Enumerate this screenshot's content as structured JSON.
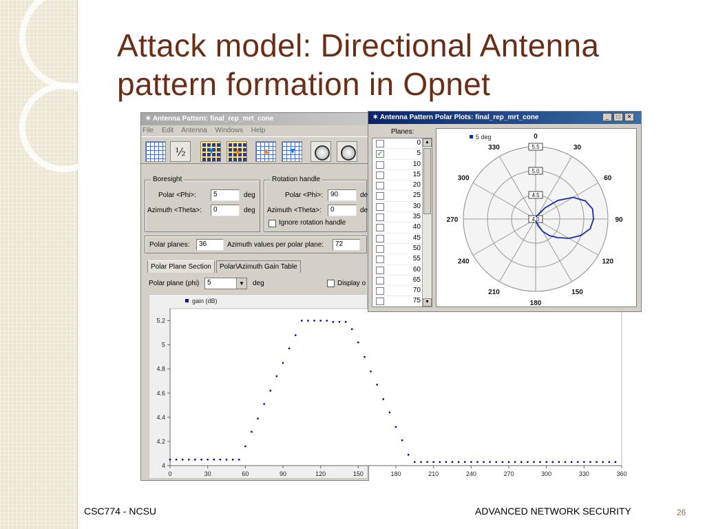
{
  "slide": {
    "title_line1": "Attack model:  Directional Antenna",
    "title_line2": "pattern formation in Opnet",
    "footer_left": "CSC774  - NCSU",
    "footer_right": "ADVANCED NETWORK SECURITY",
    "page_number": "26",
    "title_color": "#6a2e16"
  },
  "main_window": {
    "title": "Antenna Pattern: final_rep_mrt_cone",
    "menu": [
      "File",
      "Edit",
      "Antenna",
      "Windows",
      "Help"
    ],
    "toolbar_icons": [
      "grid-icon",
      "fraction-sum-icon",
      "grid-down-icon",
      "grid-up-icon",
      "table-up-icon",
      "table-down-icon",
      "sphere-icon",
      "polar-grid-icon"
    ],
    "boresight": {
      "label": "Boresight",
      "polar_label": "Polar <Phi>:",
      "polar_value": "5",
      "azimuth_label": "Azimuth <Theta>:",
      "azimuth_value": "0",
      "unit": "deg"
    },
    "rotation": {
      "label": "Rotation handle",
      "polar_label": "Polar <Phi>:",
      "polar_value": "90",
      "azimuth_label": "Azimuth <Theta>:",
      "azimuth_value": "0",
      "unit": "de",
      "ignore_label": "Ignore rotation handle"
    },
    "polar_planes_label": "Polar planes:",
    "polar_planes_value": "36",
    "azimuth_values_label": "Azimuth values per polar plane:",
    "azimuth_values_value": "72",
    "tabs": [
      "Polar Plane Section",
      "Polar\\Azimuth Gain Table"
    ],
    "polar_plane_label": "Polar plane (phi)",
    "polar_plane_value": "5",
    "deg_label": "deg",
    "display_label": "Display o"
  },
  "polar_window": {
    "title": "Antenna Pattern Polar Plots: final_rep_mrt_cone",
    "planes_label": "Planes:",
    "planes": [
      "0",
      "5",
      "10",
      "15",
      "20",
      "25",
      "30",
      "35",
      "40",
      "45",
      "50",
      "55",
      "60",
      "65",
      "70",
      "75"
    ],
    "checked_plane": "5"
  },
  "chart_data": [
    {
      "type": "scatter",
      "series": [
        {
          "name": "gain (dB)",
          "color": "#00008b"
        }
      ],
      "x": [
        0,
        5,
        10,
        15,
        20,
        25,
        30,
        35,
        40,
        45,
        50,
        55,
        60,
        65,
        70,
        75,
        80,
        85,
        90,
        95,
        100,
        105,
        110,
        115,
        120,
        125,
        130,
        135,
        140,
        145,
        150,
        155,
        160,
        165,
        170,
        175,
        180,
        185,
        190,
        195,
        200,
        205,
        210,
        215,
        220,
        225,
        230,
        235,
        240,
        245,
        250,
        255,
        260,
        265,
        270,
        275,
        280,
        285,
        290,
        295,
        300,
        305,
        310,
        315,
        320,
        325,
        330,
        335,
        340,
        345,
        350,
        355
      ],
      "y": [
        4.05,
        4.05,
        4.05,
        4.05,
        4.05,
        4.05,
        4.05,
        4.05,
        4.05,
        4.05,
        4.05,
        4.05,
        4.16,
        4.28,
        4.39,
        4.51,
        4.62,
        4.74,
        4.85,
        4.97,
        5.08,
        5.2,
        5.2,
        5.2,
        5.2,
        5.2,
        5.19,
        5.19,
        5.19,
        5.13,
        5.02,
        4.9,
        4.78,
        4.67,
        4.55,
        4.44,
        4.32,
        4.21,
        4.09,
        4.03,
        4.03,
        4.03,
        4.03,
        4.03,
        4.03,
        4.03,
        4.03,
        4.03,
        4.03,
        4.03,
        4.03,
        4.03,
        4.03,
        4.03,
        4.03,
        4.03,
        4.03,
        4.03,
        4.03,
        4.03,
        4.03,
        4.03,
        4.03,
        4.03,
        4.03,
        4.03,
        4.03,
        4.03,
        4.03,
        4.03,
        4.03,
        4.03
      ],
      "xlim": [
        0,
        360
      ],
      "ylim": [
        4,
        5.3
      ],
      "xticks": [
        "0",
        "30",
        "60",
        "90",
        "120",
        "150",
        "180",
        "210",
        "240",
        "270",
        "300",
        "330",
        "360"
      ],
      "yticks": [
        "4",
        "4.2",
        "4.4",
        "4.6",
        "4.8",
        "5",
        "5.2"
      ],
      "legend_position": "top-left",
      "grid": false
    },
    {
      "type": "line",
      "polar": true,
      "series": [
        {
          "name": "5 deg",
          "color": "#1428b4"
        }
      ],
      "r_labels": [
        "4.0",
        "4.5",
        "5.0",
        "5.5"
      ],
      "rlim": [
        4.0,
        5.5
      ],
      "angle_labels": [
        "0",
        "30",
        "60",
        "90",
        "120",
        "150",
        "180",
        "210",
        "240",
        "270",
        "300",
        "330"
      ],
      "theta": [
        0,
        10,
        20,
        30,
        40,
        50,
        60,
        70,
        80,
        90,
        100,
        110,
        120,
        130,
        140,
        150,
        160,
        170,
        180
      ],
      "r": [
        4.05,
        4.05,
        4.07,
        4.1,
        4.3,
        4.6,
        4.9,
        5.1,
        5.2,
        5.2,
        5.15,
        5.0,
        4.8,
        4.6,
        4.45,
        4.3,
        4.15,
        4.05,
        4.03
      ],
      "legend_position": "top-left",
      "grid": true
    }
  ]
}
